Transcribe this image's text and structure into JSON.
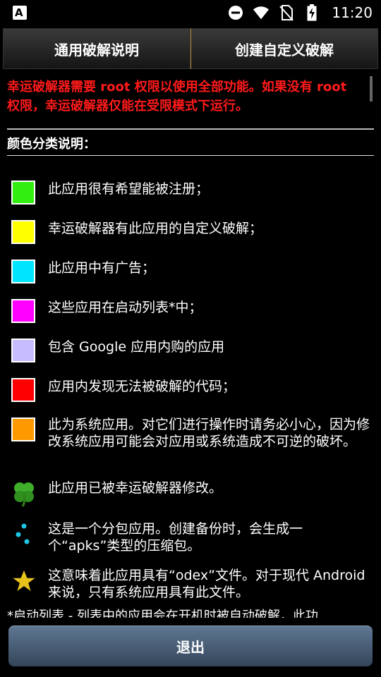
{
  "status_bar": {
    "time": "11:20",
    "left_icon": "A",
    "icons": [
      "do-not-disturb-icon",
      "wifi-icon",
      "no-sim-icon",
      "battery-charging-icon"
    ]
  },
  "tabs": [
    {
      "label": "通用破解说明"
    },
    {
      "label": "创建自定义破解"
    }
  ],
  "warning": "幸运破解器需要 root 权限以使用全部功能。如果没有 root 权限，幸运破解器仅能在受限模式下运行。",
  "legend_title": "颜色分类说明：",
  "legend": [
    {
      "color": "#33ee11",
      "text": "此应用很有希望能被注册；"
    },
    {
      "color": "#ffff00",
      "text": "幸运破解器有此应用的自定义破解；"
    },
    {
      "color": "#00e5ff",
      "text": "此应用中有广告；"
    },
    {
      "color": "#ff00ff",
      "text": "这些应用在启动列表*中；"
    },
    {
      "color": "#c6bcff",
      "text": "包含 Google 应用内购的应用"
    },
    {
      "color": "#ff0000",
      "text": "应用内发现无法被破解的代码；"
    },
    {
      "color": "#ff9900",
      "text": "此为系统应用。对它们进行操作时请务必小心，因为修改系统应用可能会对应用或系统造成不可逆的破坏。"
    }
  ],
  "icon_legend": [
    {
      "icon": "clover-icon",
      "text": "此应用已被幸运破解器修改。"
    },
    {
      "icon": "split-apk-icon",
      "text": "这是一个分包应用。创建备份时，会生成一个“apks”类型的压缩包。"
    },
    {
      "icon": "star-icon",
      "text": "这意味着此应用具有“odex”文件。对于现代 Android 来说，只有系统应用具有此文件。"
    }
  ],
  "footnote": "*启动列表 - 列表中的应用会在开机时被自动破解，此功",
  "exit_label": "退出"
}
